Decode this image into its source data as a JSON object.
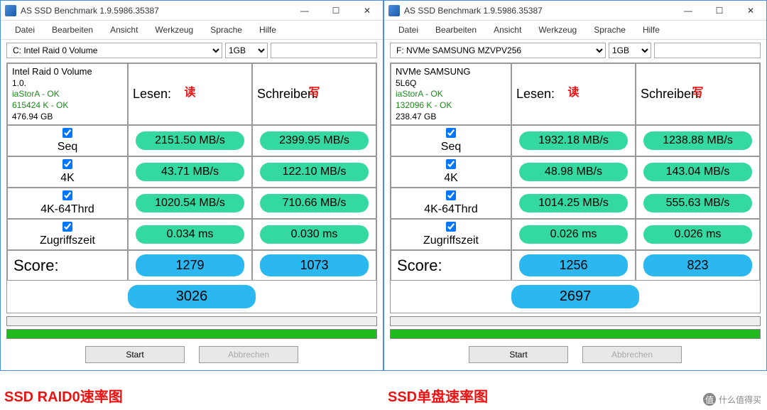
{
  "app_title": "AS SSD Benchmark 1.9.5986.35387",
  "menu": [
    "Datei",
    "Bearbeiten",
    "Ansicht",
    "Werkzeug",
    "Sprache",
    "Hilfe"
  ],
  "size_label": "1GB",
  "headers": {
    "read": "Lesen:",
    "write": "Schreiben:",
    "read_anno": "读",
    "write_anno": "写"
  },
  "rows": {
    "seq": "Seq",
    "fourk": "4K",
    "fourk64": "4K-64Thrd",
    "access": "Zugriffszeit",
    "score": "Score:"
  },
  "buttons": {
    "start": "Start",
    "cancel": "Abbrechen"
  },
  "left": {
    "drive": "C: Intel Raid 0 Volume",
    "info": {
      "name": "Intel Raid 0 Volume",
      "ver": "1.0.",
      "drv": "iaStorA - OK",
      "align": "615424 K - OK",
      "size": "476.94 GB"
    },
    "seq_r": "2151.50 MB/s",
    "seq_w": "2399.95 MB/s",
    "fk_r": "43.71 MB/s",
    "fk_w": "122.10 MB/s",
    "fk64_r": "1020.54 MB/s",
    "fk64_w": "710.66 MB/s",
    "acc_r": "0.034 ms",
    "acc_w": "0.030 ms",
    "score_r": "1279",
    "score_w": "1073",
    "total": "3026",
    "caption": "SSD RAID0速率图"
  },
  "right": {
    "drive": "F: NVMe SAMSUNG MZVPV256",
    "info": {
      "name": "NVMe SAMSUNG",
      "ver": "5L6Q",
      "drv": "iaStorA - OK",
      "align": "132096 K - OK",
      "size": "238.47 GB"
    },
    "seq_r": "1932.18 MB/s",
    "seq_w": "1238.88 MB/s",
    "fk_r": "48.98 MB/s",
    "fk_w": "143.04 MB/s",
    "fk64_r": "1014.25 MB/s",
    "fk64_w": "555.63 MB/s",
    "acc_r": "0.026 ms",
    "acc_w": "0.026 ms",
    "score_r": "1256",
    "score_w": "823",
    "total": "2697",
    "caption": "SSD单盘速率图"
  },
  "watermark": "什么值得买"
}
